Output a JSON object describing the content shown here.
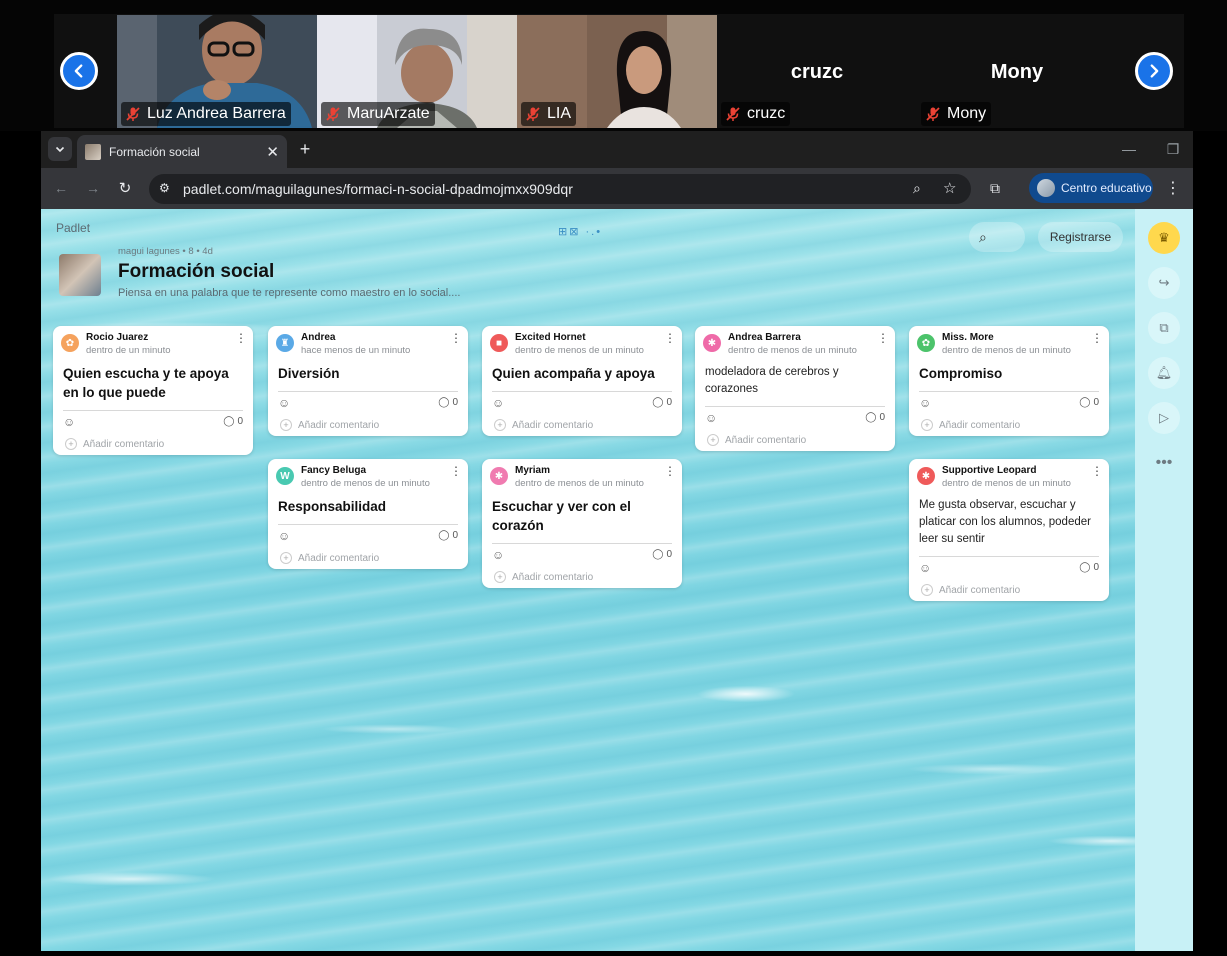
{
  "meeting": {
    "participants": [
      {
        "name": "Luz Andrea Barrera"
      },
      {
        "name": "MaruArzate"
      },
      {
        "name": "LIA"
      },
      {
        "name": "cruzc",
        "display": "cruzc"
      },
      {
        "name": "Mony",
        "display": "Mony"
      }
    ]
  },
  "browser": {
    "tab_title": "Formación social",
    "url": "padlet.com/maguilagunes/formaci-n-social-dpadmojmxx909dqr",
    "profile_label": "Centro educativo"
  },
  "padlet": {
    "logo": "Padlet",
    "meta": "magui lagunes • 8 • 4d",
    "title": "Formación social",
    "subtitle": "Piensa en una palabra que te represente como maestro en lo social....",
    "signup_label": "Registrarse",
    "add_comment_label": "Añadir comentario",
    "cards": [
      {
        "author": "Rocio Juarez",
        "time": "dentro de un minuto",
        "title": "Quien escucha y te apoya en lo que puede",
        "body": "",
        "count": "0",
        "color": "#f5a25d",
        "avatar": "✿"
      },
      {
        "author": "Andrea",
        "time": "hace menos de un minuto",
        "title": "Diversión",
        "body": "",
        "count": "0",
        "color": "#5aa9e6",
        "avatar": "♜"
      },
      {
        "author": "Excited Hornet",
        "time": "dentro de menos de un minuto",
        "title": "Quien acompaña y apoya",
        "body": "",
        "count": "0",
        "color": "#ef5a5a",
        "avatar": "■"
      },
      {
        "author": "Andrea Barrera",
        "time": "dentro de menos de un minuto",
        "title": "",
        "body": "modeladora de cerebros  y corazones",
        "count": "0",
        "color": "#ef6aa8",
        "avatar": "✱"
      },
      {
        "author": "Miss. More",
        "time": "dentro de menos de un minuto",
        "title": "Compromiso",
        "body": "",
        "count": "0",
        "color": "#4cc36b",
        "avatar": "✿"
      },
      {
        "author": "Fancy Beluga",
        "time": "dentro de menos de un minuto",
        "title": "Responsabilidad",
        "body": "",
        "count": "0",
        "color": "#49c9b1",
        "avatar": "W"
      },
      {
        "author": "Myriam",
        "time": "dentro de menos de un minuto",
        "title": "Escuchar y ver con el corazón",
        "body": "",
        "count": "0",
        "color": "#f07bb0",
        "avatar": "✱"
      },
      {
        "author": "Supportive Leopard",
        "time": "dentro de menos de un minuto",
        "title": "",
        "body": "Me gusta observar, escuchar y platicar con los alumnos, podeder leer su sentir",
        "count": "0",
        "color": "#ef5a5a",
        "avatar": "✱"
      }
    ]
  }
}
